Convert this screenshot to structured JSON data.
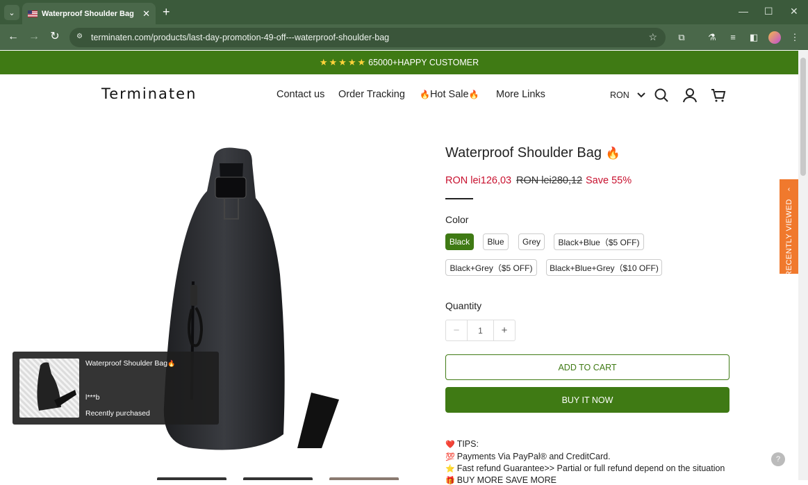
{
  "browser": {
    "tab_title": "Waterproof Shoulder Bag",
    "url": "terminaten.com/products/last-day-promotion-49-off---waterproof-shoulder-bag"
  },
  "announcement": {
    "stars": "★★★★★",
    "text": "65000+HAPPY CUSTOMER"
  },
  "header": {
    "logo": "Terminaten",
    "nav": [
      "Contact us",
      "Order Tracking",
      "Hot Sale",
      "More Links"
    ],
    "currency": "RON"
  },
  "product": {
    "title": "Waterproof Shoulder Bag",
    "price": "RON lei126,03",
    "compare_price": "RON lei280,12",
    "save": "Save 55%",
    "color_label": "Color",
    "colors": [
      "Black",
      "Blue",
      "Grey",
      "Black+Blue（$5 OFF)",
      "Black+Grey（$5 OFF)",
      "Black+Blue+Grey（$10 OFF)"
    ],
    "selected_color": "Black",
    "quantity_label": "Quantity",
    "quantity": "1",
    "add_to_cart": "ADD TO CART",
    "buy_now": "BUY IT NOW",
    "tips": [
      "TIPS:",
      "Payments Via PayPal® and CreditCard.",
      "Fast refund Guarantee>> Partial or full refund depend on the situation",
      "BUY MORE SAVE MORE"
    ]
  },
  "recently_viewed": "RECENTLY VIEWED",
  "popup": {
    "title": "Waterproof Shoulder Bag",
    "buyer": "l***b",
    "status": "Recently purchased"
  },
  "colors": {
    "brand_green": "#3f7a14",
    "sale_red": "#c8102e",
    "tab_orange": "#f0792d"
  }
}
